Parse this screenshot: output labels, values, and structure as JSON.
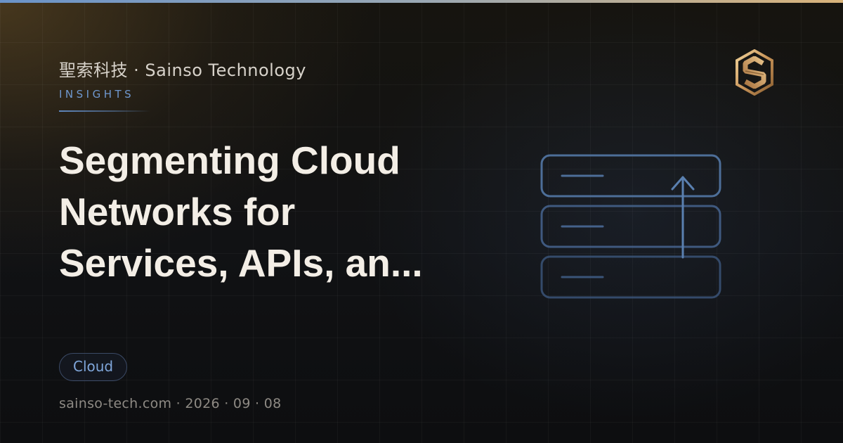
{
  "brand": {
    "name": "聖索科技 · Sainso Technology",
    "logo_icon": "sainso-s-hexagon-logo"
  },
  "kicker": "INSIGHTS",
  "title_lines": [
    "Segmenting Cloud",
    "Networks for",
    "Services, APIs, an..."
  ],
  "tag": "Cloud",
  "footer": "sainso-tech.com · 2026 · 09 · 08",
  "illustration_icon": "stacked-servers-upload-icon",
  "colors": {
    "accent_blue": "#6f98cf",
    "gold": "#d9b37a",
    "title": "#f3eee6",
    "background": "#0e0f12"
  }
}
